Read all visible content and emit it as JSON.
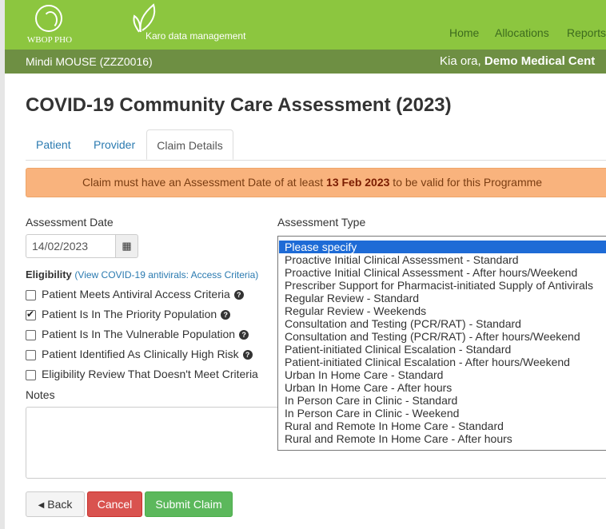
{
  "header": {
    "logo_text": "WBOP PHO",
    "brand_text": "Karo data management",
    "nav": [
      "Home",
      "Allocations",
      "Reports"
    ],
    "patient": "Mindi MOUSE (ZZZ0016)",
    "greeting_prefix": "Kia ora,",
    "greeting_name": "Demo Medical Cent"
  },
  "page": {
    "title": "COVID-19 Community Care Assessment (2023)",
    "tabs": [
      "Patient",
      "Provider",
      "Claim Details"
    ],
    "active_tab": "Claim Details"
  },
  "alert": {
    "before": "Claim must have an Assessment Date of at least ",
    "date": "13 Feb 2023",
    "after": " to be valid for this Programme"
  },
  "form": {
    "assessment_date_label": "Assessment Date",
    "assessment_date_value": "14/02/2023",
    "assessment_type_label": "Assessment Type",
    "eligibility_label": "Eligibility",
    "eligibility_link": "(View COVID-19 antivirals: Access Criteria)",
    "checkboxes": [
      {
        "label": "Patient Meets Antiviral Access Criteria",
        "checked": false,
        "help": true
      },
      {
        "label": "Patient Is In The Priority Population",
        "checked": true,
        "help": true
      },
      {
        "label": "Patient Is In The Vulnerable Population",
        "checked": false,
        "help": true
      },
      {
        "label": "Patient Identified As Clinically High Risk",
        "checked": false,
        "help": true
      },
      {
        "label": "Eligibility Review That Doesn't Meet Criteria",
        "checked": false,
        "help": false
      }
    ],
    "notes_label": "Notes",
    "notes_value": "",
    "assessment_type_options": [
      "Please specify",
      "Proactive Initial Clinical Assessment - Standard",
      "Proactive Initial Clinical Assessment - After hours/Weekend",
      "Prescriber Support for Pharmacist-initiated Supply of Antivirals",
      "Regular Review - Standard",
      "Regular Review - Weekends",
      "Consultation and Testing (PCR/RAT) - Standard",
      "Consultation and Testing (PCR/RAT) - After hours/Weekend",
      "Patient-initiated Clinical Escalation - Standard",
      "Patient-initiated Clinical Escalation - After hours/Weekend",
      "Urban In Home Care - Standard",
      "Urban In Home Care - After hours",
      "In Person Care in Clinic - Standard",
      "In Person Care in Clinic - Weekend",
      "Rural and Remote In Home Care - Standard",
      "Rural and Remote In Home Care - After hours"
    ],
    "selected_option": "Please specify"
  },
  "buttons": {
    "back": "Back",
    "cancel": "Cancel",
    "submit": "Submit Claim"
  },
  "colors": {
    "header_green": "#8cc63f",
    "subbar_green": "#6e8f43",
    "alert_bg": "#f9b37d",
    "cancel_red": "#d9534f",
    "submit_green": "#5cb85c",
    "link_blue": "#2a7ab0",
    "selection_blue": "#1e6bd6"
  }
}
